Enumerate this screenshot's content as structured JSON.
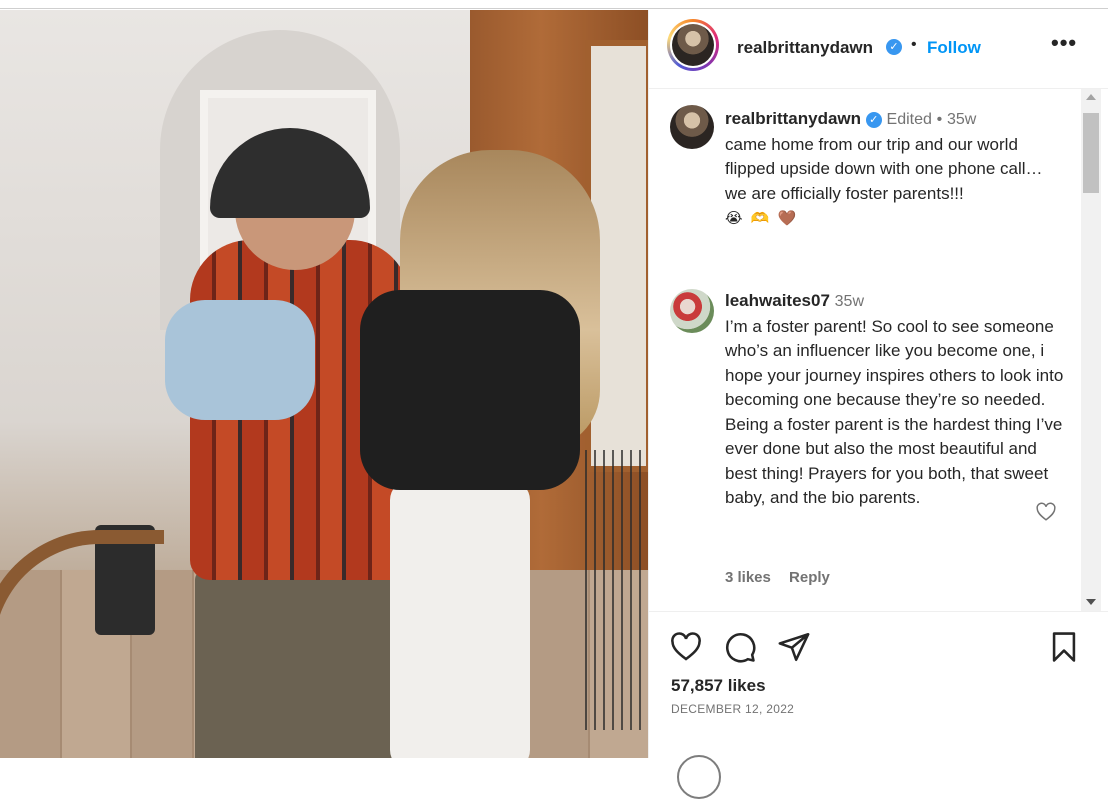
{
  "post": {
    "username": "realbrittanydawn",
    "follow_label": "Follow",
    "separator": "•",
    "more_label": "•••",
    "verified_badge": "✓"
  },
  "caption": {
    "username": "realbrittanydawn",
    "edited": "Edited",
    "dot": "•",
    "time": "35w",
    "text": "came home from our trip and our world flipped upside down with one phone call… we are officially foster parents!!!",
    "emojis": "😭 🫶 🤎"
  },
  "comment": {
    "username": "leahwaites07",
    "time": "35w",
    "text": "I’m a foster parent! So cool to see someone who’s an influencer like you become one, i hope your journey inspires others to look into becoming one because they’re so needed. Being a foster parent is the hardest thing I’ve ever done but also the most beautiful and best thing! Prayers for you both, that sweet baby, and the bio parents.",
    "likes": "3 likes",
    "reply": "Reply"
  },
  "footer": {
    "likes": "57,857 likes",
    "date": "DECEMBER 12, 2022"
  },
  "icons": [
    "heart-icon",
    "comment-icon",
    "share-icon",
    "bookmark-icon",
    "more-icon"
  ]
}
